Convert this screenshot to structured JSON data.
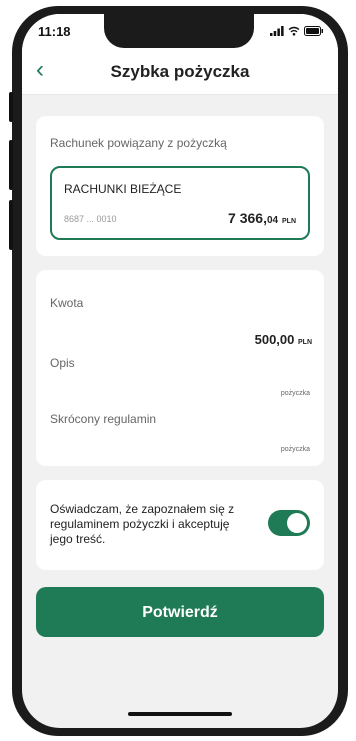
{
  "status_bar": {
    "time": "11:18"
  },
  "header": {
    "title": "Szybka pożyczka",
    "back_icon": "chevron-left"
  },
  "account_card": {
    "label": "Rachunek powiązany z pożyczką",
    "account_name": "RACHUNKI BIEŻĄCE",
    "account_number": "8687 ... 0010",
    "balance_amount": "7 366,",
    "balance_cents": "04",
    "currency": "PLN"
  },
  "details_card": {
    "amount_label": "Kwota",
    "amount_value": "500,00",
    "amount_currency": "PLN",
    "description_label": "Opis",
    "description_value": "pożyczka",
    "terms_label": "Skrócony regulamin",
    "terms_value": "pożyczka"
  },
  "consent": {
    "text": "Oświadczam, że zapoznałem się z regulaminem pożyczki i akceptuję jego treść.",
    "toggle_on": true
  },
  "confirm_button": {
    "label": "Potwierdź"
  },
  "colors": {
    "accent": "#1f7a56",
    "background": "#f1f1f1"
  }
}
